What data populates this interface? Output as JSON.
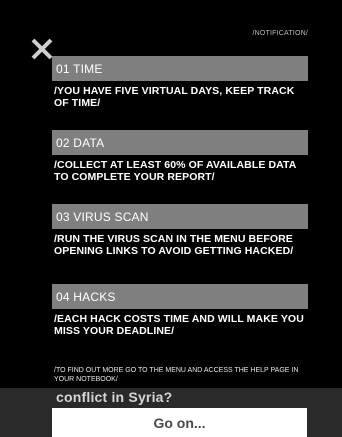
{
  "notification_label": "/NOTIFICATION/",
  "items": [
    {
      "title": "01 TIME",
      "description": "/YOU HAVE FIVE VIRTUAL DAYS, KEEP TRACK OF TIME/"
    },
    {
      "title": "02 DATA",
      "description": "/COLLECT AT LEAST 60% OF AVAILABLE DATA TO COMPLETE YOUR REPORT/"
    },
    {
      "title": "03 VIRUS SCAN",
      "description": "/RUN THE VIRUS SCAN IN THE MENU BEFORE OPENING LINKS TO AVOID GETTING HACKED/"
    },
    {
      "title": "04 HACKS",
      "description": "/EACH HACK COSTS TIME AND WILL MAKE YOU MISS YOUR DEADLINE/"
    }
  ],
  "footer_note": "/TO FIND OUT MORE GO TO THE MENU AND ACCESS THE HELP PAGE IN YOUR NOTEBOOK/",
  "underlay_text": "conflict in Syria?",
  "go_button_label": "Go on...",
  "colors": {
    "background": "#000000",
    "title_bar": "#7f7f7f",
    "button_bg": "#ffffff"
  }
}
